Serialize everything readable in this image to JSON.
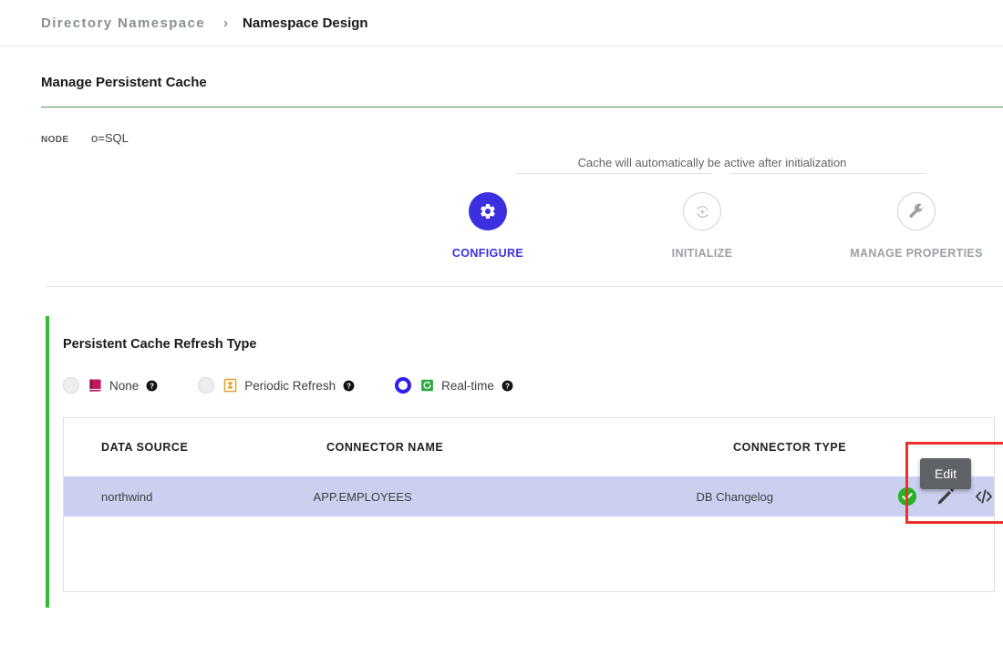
{
  "breadcrumb": {
    "root": "Directory Namespace",
    "separator": "›",
    "current": "Namespace Design"
  },
  "page": {
    "title": "Manage Persistent Cache",
    "title_rule_color": "#4d9a4f"
  },
  "node": {
    "label": "NODE",
    "value": "o=SQL"
  },
  "stepper": {
    "hint": "Cache will automatically be active after initialization",
    "active_color": "#3c2fe0",
    "idle_color": "#9aa0a6",
    "steps": [
      {
        "label": "CONFIGURE",
        "icon": "gear-icon",
        "state": "active"
      },
      {
        "label": "INITIALIZE",
        "icon": "refresh-icon",
        "state": "idle"
      },
      {
        "label": "MANAGE PROPERTIES",
        "icon": "wrench-icon",
        "state": "idle"
      }
    ]
  },
  "refresh_section": {
    "heading": "Persistent Cache Refresh Type",
    "accent_color": "#2fbc2f",
    "options": [
      {
        "label": "None",
        "icon": "book-icon",
        "icon_color": "#c2185b",
        "selected": false,
        "help": "help-icon"
      },
      {
        "label": "Periodic Refresh",
        "icon": "clock-badge-icon",
        "icon_color": "#e0a030",
        "selected": false,
        "help": "help-icon"
      },
      {
        "label": "Real-time",
        "icon": "sync-badge-icon",
        "icon_color": "#2fa83f",
        "selected": true,
        "help": "help-icon"
      }
    ],
    "selected_radio_color": "#2e1ff0"
  },
  "table": {
    "columns": [
      "DATA SOURCE",
      "CONNECTOR NAME",
      "CONNECTOR TYPE"
    ],
    "rows": [
      {
        "data_source": "northwind",
        "connector_name": "APP.EMPLOYEES",
        "connector_type": "DB Changelog",
        "selected": true,
        "actions": [
          {
            "name": "status-ok-icon",
            "color": "#22b422"
          },
          {
            "name": "edit-pencil-icon",
            "color": "#3c4043"
          },
          {
            "name": "code-icon",
            "color": "#3c4043"
          }
        ]
      }
    ],
    "row_highlight_color": "#ccd0f0"
  },
  "tooltip": {
    "text": "Edit",
    "background": "#5f6368"
  },
  "highlight_box": {
    "color": "#e8322b"
  }
}
